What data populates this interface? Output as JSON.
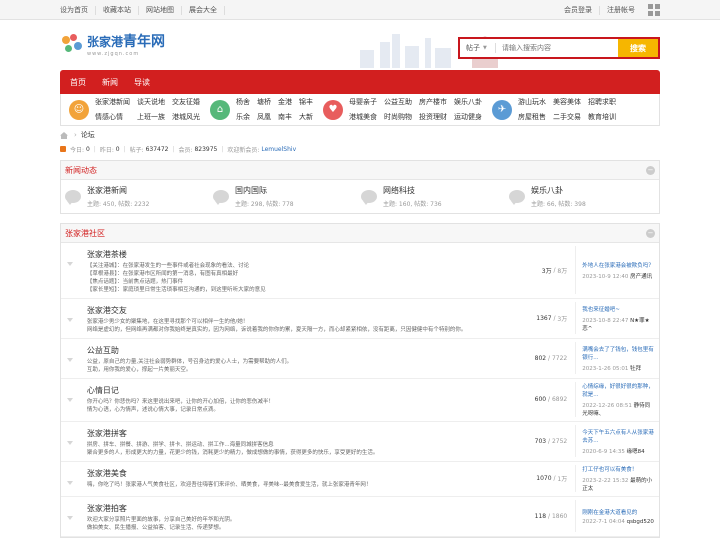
{
  "topbar": {
    "left_links": [
      "设为首页",
      "收藏本站",
      "网站地图",
      "展会大全"
    ],
    "right_links": [
      "会员登录",
      "注册帐号"
    ]
  },
  "logo": {
    "part1": "张家港",
    "part2": "青年网",
    "url": "www.zjgqn.com"
  },
  "search": {
    "type_label": "帖子",
    "placeholder": "请输入搜索内容",
    "button_label": "搜索"
  },
  "nav": [
    "首页",
    "新闻",
    "导读"
  ],
  "categories": [
    {
      "icon": "chat-icon",
      "color": "#f2a33a",
      "glyph": "☺",
      "links": [
        "张家港新闻",
        "谈天说地",
        "交友征婚",
        "情感心情",
        "上班一族",
        "港城风光"
      ]
    },
    {
      "icon": "town-icon",
      "color": "#56b87a",
      "glyph": "⌂",
      "links": [
        "杨舍",
        "塘桥",
        "金港",
        "锦丰",
        "乐余",
        "凤凰",
        "南丰",
        "大新"
      ]
    },
    {
      "icon": "house-icon",
      "color": "#e85d5d",
      "glyph": "♥",
      "links": [
        "母婴亲子",
        "公益互助",
        "房产楼市",
        "娱乐八卦",
        "港城美食",
        "时尚购物",
        "投资理财",
        "运动健身"
      ]
    },
    {
      "icon": "car-icon",
      "color": "#5b9bd5",
      "glyph": "✈",
      "links": [
        "游山玩水",
        "美容美体",
        "招聘求职",
        "房屋租售",
        "二手交易",
        "教育培训"
      ]
    }
  ],
  "breadcrumb": {
    "current": "论坛"
  },
  "stats": {
    "today_label": "今日:",
    "today": "0",
    "yesterday_label": "昨日:",
    "yesterday": "0",
    "posts_label": "帖子:",
    "posts": "637472",
    "members_label": "会员:",
    "members": "823975",
    "welcome_label": "欢迎新会员:",
    "new_member": "LemuelShiv"
  },
  "news_section": {
    "title": "新闻动态",
    "items": [
      {
        "name": "张家港新闻",
        "meta": "主题: 450, 帖数: 2232"
      },
      {
        "name": "国内国际",
        "meta": "主题: 298, 帖数: 778"
      },
      {
        "name": "网络科技",
        "meta": "主题: 160, 帖数: 736"
      },
      {
        "name": "娱乐八卦",
        "meta": "主题: 66, 帖数: 398"
      }
    ]
  },
  "community_section": {
    "title": "张家港社区",
    "forums": [
      {
        "name": "张家港茶楼",
        "desc": [
          "【关注港城】：在张家港发生的一些事件或者社会现象的看法、讨论",
          "【草根港县】：在张家港市区所闻的第一消息，有图有真相最好",
          "【焦点话题】：当前焦点话题，热门事件",
          "【家长里短】：家庭琐里日常生活琐事相互沟通的，到这里听听大家的意见"
        ],
        "count1": "3万",
        "count2": "8万",
        "last_title": "外地人在张家港会被欺负吗？",
        "last_time": "2023-10-9 12:40",
        "last_user": "房产通讯"
      },
      {
        "name": "张家港交友",
        "desc": [
          "张家港少男少女的聚集地，在这里寻找那个可以相伴一生的他/她！",
          "网络是虚幻的，但网络再满都对你我始终是真实的，因为网络，诉说着我的你你的累，夏天隔一方，而心却紧紧相依，没有距离，只因健健中有个特别的你。"
        ],
        "count1": "1367",
        "count2": "3万",
        "last_title": "我也来征婚吧~",
        "last_time": "2023-10-8 22:47",
        "last_user": "N★罪★恋^"
      },
      {
        "name": "公益互助",
        "desc": [
          "公益，原自己的力量,关注社会弱势群体，号召身边的爱心人士，为需要帮助的人们。",
          "互助，用你我的爱心，撑起一片美丽天空。"
        ],
        "count1": "802",
        "count2": "7722",
        "last_title": "满嘴会去了了钱包，钱包里有银行...",
        "last_time": "2023-1-26 05:01",
        "last_user": "牡拜"
      },
      {
        "name": "心情日记",
        "desc": [
          "你开心吗？你悲伤吗？来这里说出来吧，让你的开心加倍，让你的悲伤减半！",
          "情为心语，心为情声，述说心情大事，记录日常点滴。"
        ],
        "count1": "600",
        "count2": "6892",
        "last_title": "心情综缘，好很好很的那种，就是...",
        "last_time": "2022-12-26 08:51",
        "last_user": "静待同光呀嘛、"
      },
      {
        "name": "张家港拼客",
        "desc": [
          "拼房、拼车、拼餐、拼游、拼学、拼卡、拼运动、拼工作...海量同城拼客信息",
          "聚合更多的人，形成更大的力量，花更少的钱，消耗更少的精力，做成想做的事情，获得更多的快乐，享受更好的生活。"
        ],
        "count1": "703",
        "count2": "2752",
        "last_title": "今天下午五六点有人从张家港去苏...",
        "last_time": "2020-6-9 14:35",
        "last_user": "缘嗯84"
      },
      {
        "name": "张家港美食",
        "desc": [
          "嗨，你吃了吗！张家港人气美食社区，欢迎吾往嗨客们来评价、晒美食，寻美味--最美食爱生活，就上张家港青年网！"
        ],
        "count1": "1070",
        "count2": "1万",
        "last_title": "打工仔也可以有美食！",
        "last_time": "2023-2-22 15:32",
        "last_user": "最萌的小正太"
      },
      {
        "name": "张家港拍客",
        "desc": [
          "欢迎大家分享照片里面的故事，分享自己美好的年华和光阴。",
          "做拍美女、民生播报、公益拍客、记录生活、传递梦想。"
        ],
        "count1": "118",
        "count2": "1860",
        "last_title": "刚刚在金港大道看见的",
        "last_time": "2022-7-1 04:04",
        "last_user": "qsbgd520"
      }
    ]
  }
}
